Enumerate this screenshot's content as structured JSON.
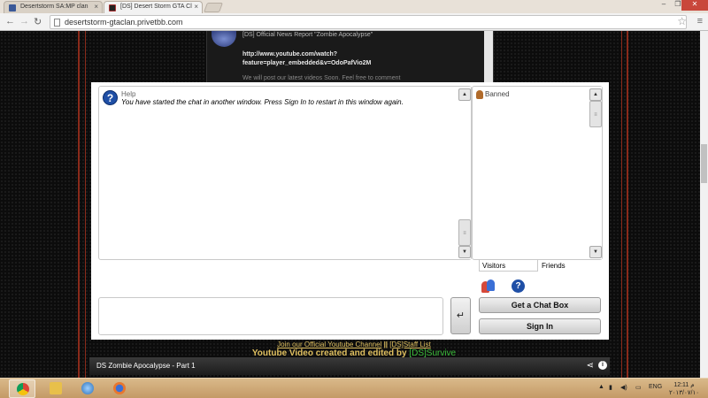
{
  "browser": {
    "tabs": [
      {
        "title": "Desertstorm SA:MP clan",
        "active": false
      },
      {
        "title": "[DS] Desert Storm GTA Cl",
        "active": true
      }
    ],
    "url": "desertstorm-gtaclan.privetbb.com"
  },
  "forum_post": {
    "title": "[DS] Official News Report \"Zombie Apocalypse\"",
    "link": "http://www.youtube.com/watch?feature=player_embedded&v=OdoPafVio2M",
    "more": "We will post our latest videos Soon. Feel free to comment"
  },
  "chat": {
    "message": {
      "user": "Help",
      "text": "You have started the chat in another window. Press Sign In to restart in this window again."
    },
    "userlist": {
      "banned_label": "Banned",
      "tabs": [
        "Visitors",
        "Friends"
      ]
    },
    "buttons": {
      "enter": "↵",
      "get_chatbox": "Get a Chat Box",
      "sign_in": "Sign In"
    }
  },
  "footer": {
    "link1": "Join our Official Youtube Channel",
    "sep": " || ",
    "link2": "[DS]Staff List",
    "credit_prefix": "Youtube Video created and edited by ",
    "credit_name": "[DS]Survive"
  },
  "video": {
    "title": "DS Zombie Apocalypse - Part 1"
  },
  "taskbar": {
    "lang": "ENG",
    "time": "12:11 م",
    "date": "٢٠١٣/٠٧/١٠"
  },
  "colors": {
    "accent_gold": "#e0c060",
    "credit_green": "#3bbd3b",
    "frame_red": "#8a2a1a"
  }
}
